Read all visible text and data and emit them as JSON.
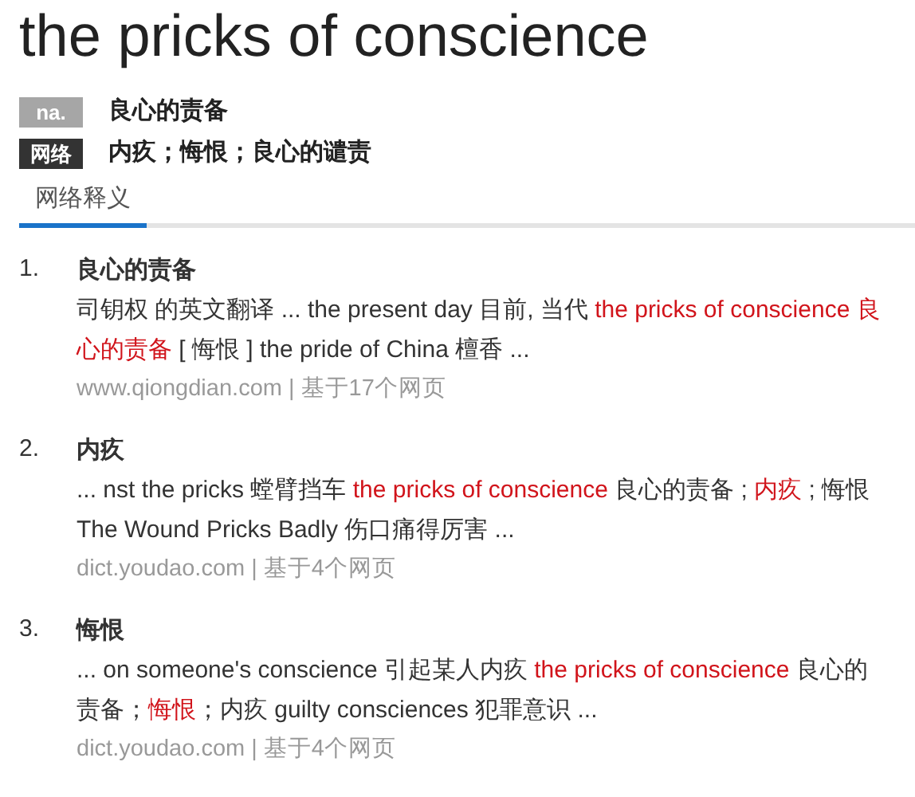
{
  "headword": "the pricks of conscience",
  "basic": [
    {
      "tag": "na.",
      "kind": "pos",
      "meaning": "良心的责备"
    },
    {
      "tag": "网络",
      "kind": "web",
      "meaning": "内疚；悔恨；良心的谴责"
    }
  ],
  "tabs": [
    {
      "label": "网络释义",
      "selected": true
    }
  ],
  "entries": [
    {
      "number": "1.",
      "term": "良心的责备",
      "snippet": [
        {
          "text": "司钥权 的英文翻译 ... the present day 目前, 当代 ",
          "highlight": false
        },
        {
          "text": "the pricks of conscience 良心的责备",
          "highlight": true
        },
        {
          "text": " [ 悔恨 ]  the pride of China 檀香 ...",
          "highlight": false
        }
      ],
      "source": "www.qiongdian.com",
      "separator": "|",
      "count": "基于17个网页"
    },
    {
      "number": "2.",
      "term": "内疚",
      "snippet": [
        {
          "text": "... nst the pricks 螳臂挡车 ",
          "highlight": false
        },
        {
          "text": "the pricks of conscience",
          "highlight": true
        },
        {
          "text": " 良心的责备 ; ",
          "highlight": false
        },
        {
          "text": "内疚",
          "highlight": true
        },
        {
          "text": " ; 悔恨 The Wound Pricks Badly 伤口痛得厉害 ...",
          "highlight": false
        }
      ],
      "source": "dict.youdao.com",
      "separator": "|",
      "count": "基于4个网页"
    },
    {
      "number": "3.",
      "term": "悔恨",
      "snippet": [
        {
          "text": "... on someone's conscience 引起某人内疚 ",
          "highlight": false
        },
        {
          "text": "the pricks of conscience",
          "highlight": true
        },
        {
          "text": " 良心的责备；",
          "highlight": false
        },
        {
          "text": "悔恨",
          "highlight": true
        },
        {
          "text": "；内疚 guilty consciences 犯罪意识 ...",
          "highlight": false
        }
      ],
      "source": "dict.youdao.com",
      "separator": "|",
      "count": "基于4个网页"
    }
  ]
}
